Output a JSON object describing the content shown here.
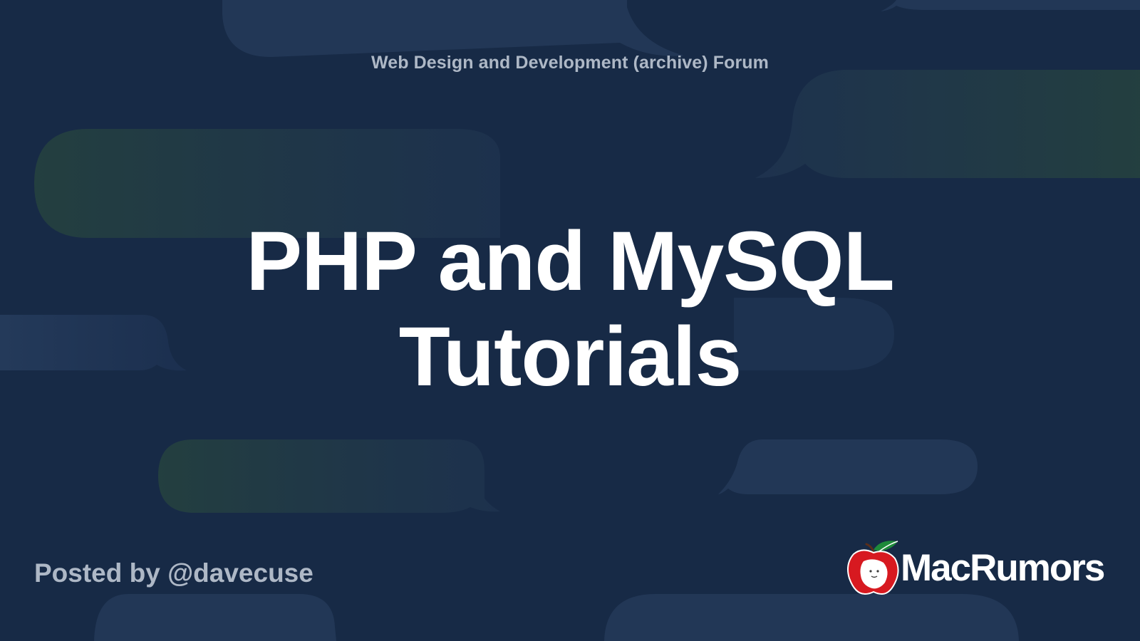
{
  "forum": {
    "name": "Web Design and Development (archive) Forum"
  },
  "thread": {
    "title_line1": "PHP and MySQL",
    "title_line2": "Tutorials"
  },
  "footer": {
    "posted_by": "Posted by @davecuse",
    "brand_name": "MacRumors",
    "brand_logo_icon": "macrumors-apple-logo-icon"
  },
  "colors": {
    "background": "#172a46",
    "bubble_blue": "#223756",
    "bubble_teal": "#24403f",
    "title_text": "#ffffff",
    "muted_text": "#aeb8c6",
    "logo_red": "#d71920",
    "logo_green": "#1e8a3a"
  }
}
